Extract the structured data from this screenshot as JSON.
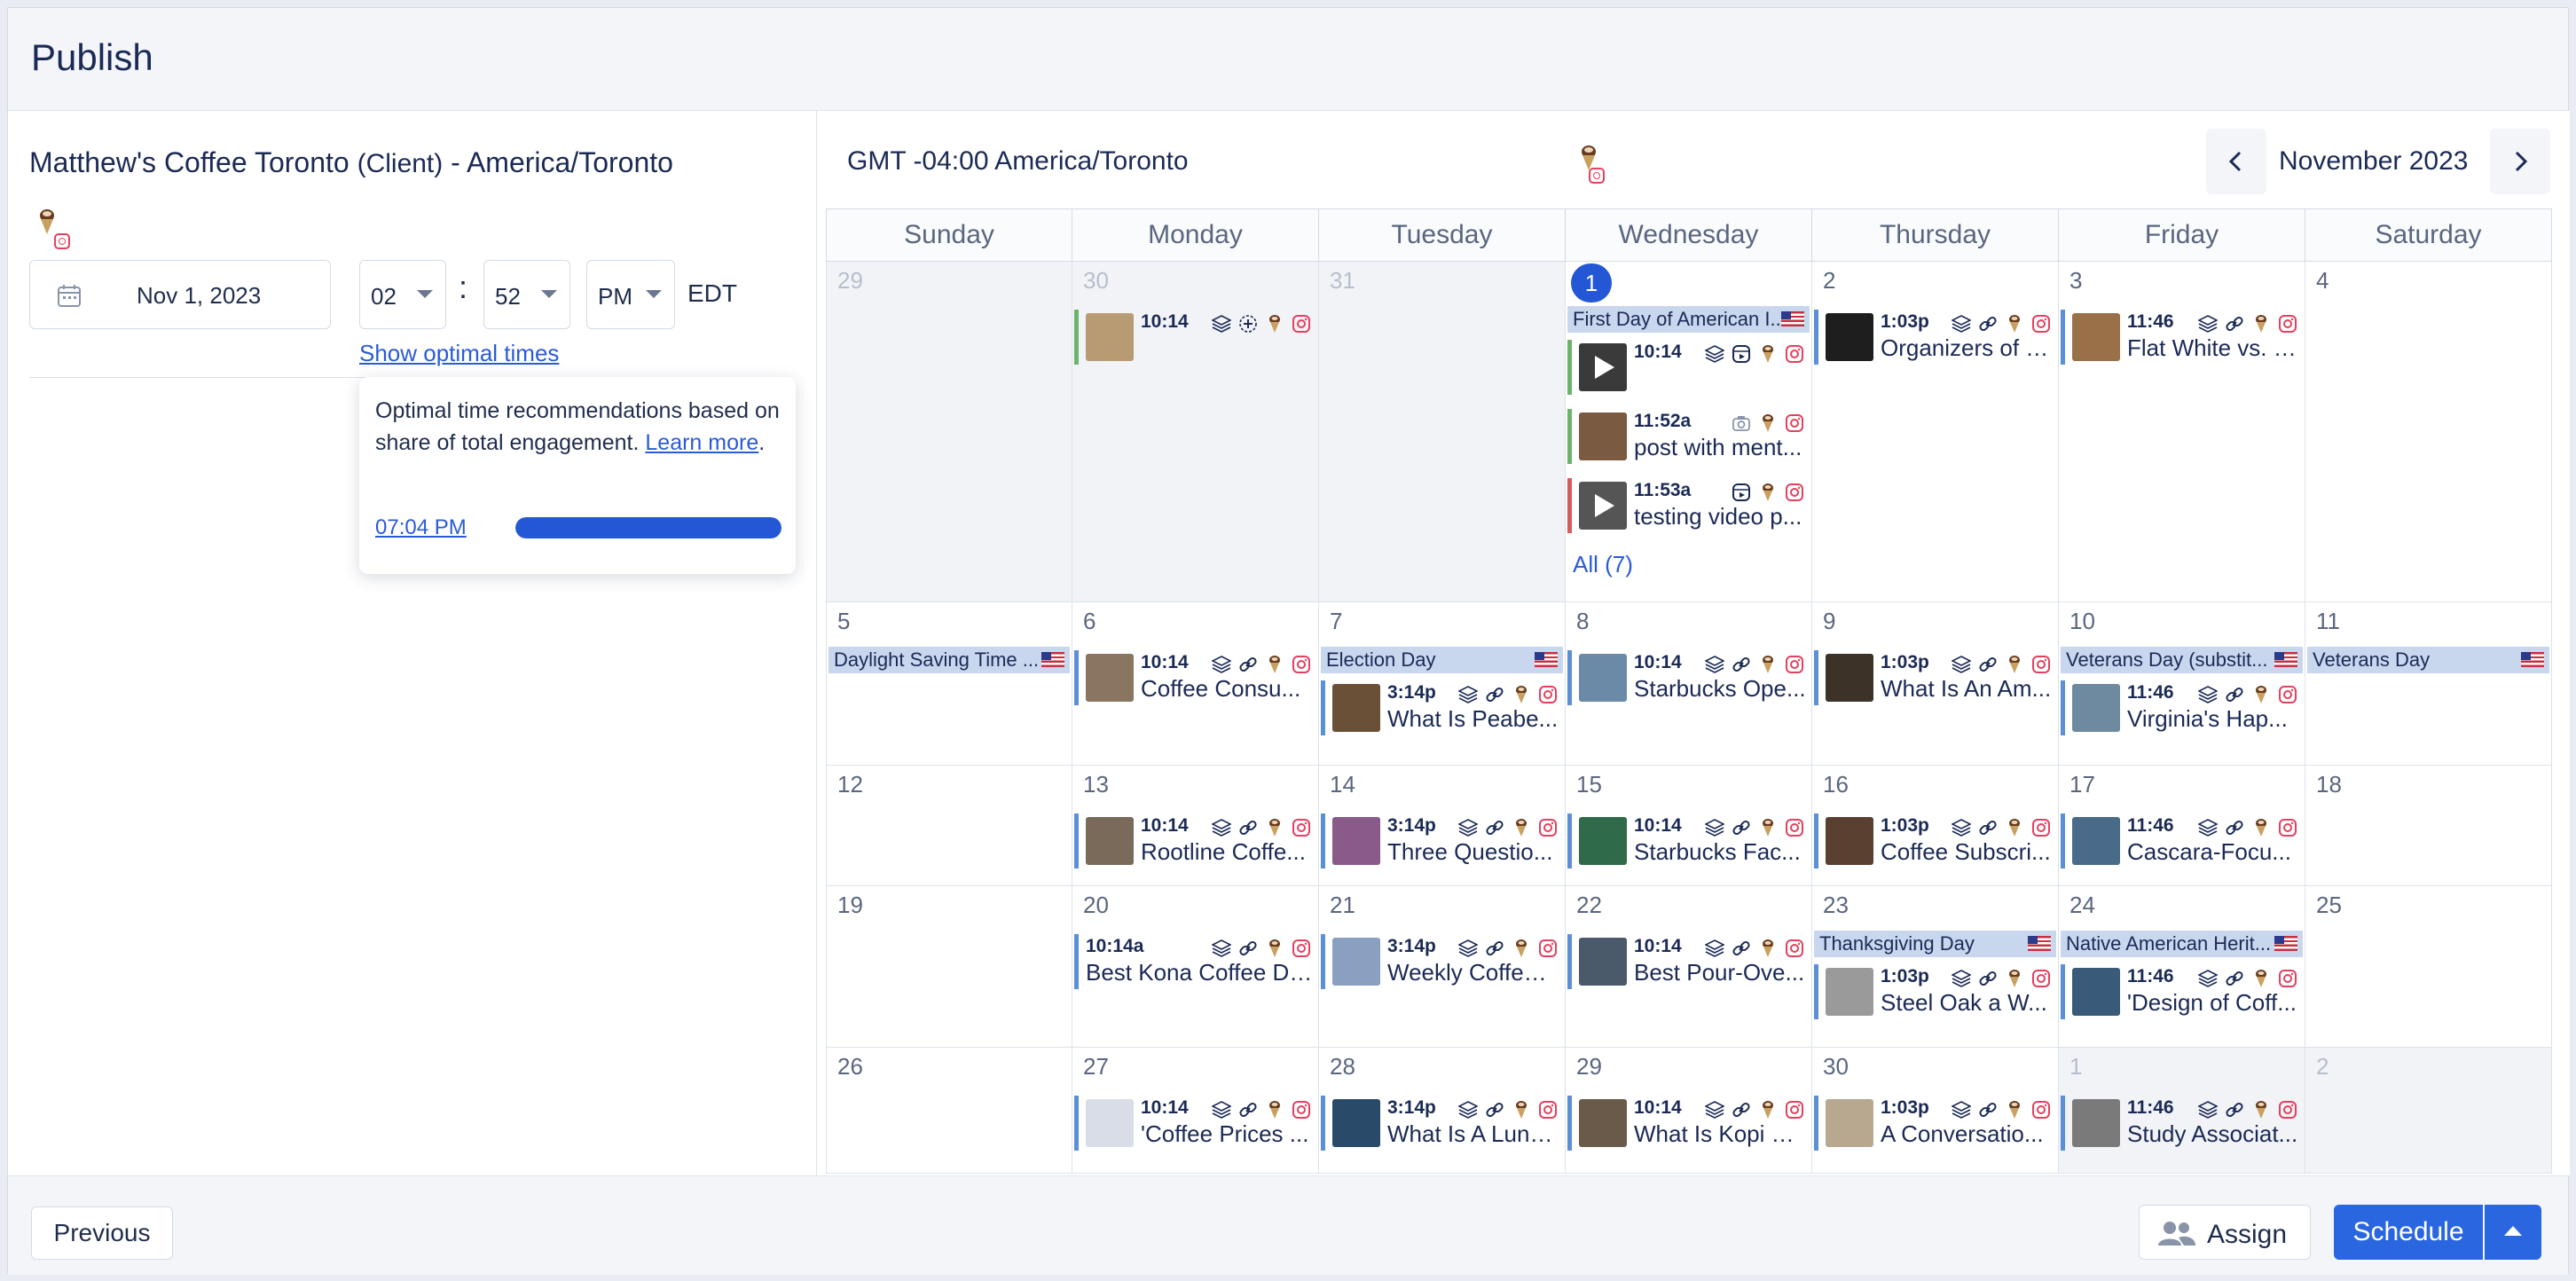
{
  "header": {
    "title": "Publish"
  },
  "left": {
    "account_name": "Matthew's Coffee Toronto",
    "account_type": "(Client)",
    "account_tz": "- America/Toronto",
    "date": "Nov 1, 2023",
    "hour": "02",
    "minute": "52",
    "ampm": "PM",
    "tz_abbr": "EDT",
    "time_separator": ":",
    "optimal_link": "Show optimal times",
    "popover": {
      "desc": "Optimal time recommendations based on share of total engagement.",
      "learn_more": "Learn more",
      "period": ".",
      "recommended_time": "07:04 PM",
      "bar_fraction": 1.0
    }
  },
  "calendar": {
    "timezone": "GMT -04:00 America/Toronto",
    "month": "November 2023",
    "days_of_week": [
      "Sunday",
      "Monday",
      "Tuesday",
      "Wednesday",
      "Thursday",
      "Friday",
      "Saturday"
    ],
    "weeks": [
      {
        "days": [
          {
            "num": "29",
            "out": true,
            "events": []
          },
          {
            "num": "30",
            "out": true,
            "events": [
              {
                "kind": "post",
                "time": "10:14",
                "title": "",
                "border": "green",
                "thumb": "#b89a73",
                "icons": [
                  "layers",
                  "add-circle",
                  "avatar",
                  "instagram"
                ]
              }
            ]
          },
          {
            "num": "31",
            "out": true,
            "events": []
          },
          {
            "num": "1",
            "today": true,
            "events": [
              {
                "kind": "holiday",
                "title": "First Day of American I..."
              },
              {
                "kind": "post",
                "time": "10:14",
                "title": "",
                "border": "green",
                "thumb": "#3a3a3a",
                "play": true,
                "icons": [
                  "layers",
                  "reel",
                  "avatar",
                  "instagram"
                ]
              },
              {
                "kind": "post",
                "time": "11:52a",
                "title": "post with ment...",
                "border": "green",
                "thumb": "#7a5a40",
                "icons": [
                  "camera",
                  "avatar",
                  "instagram"
                ]
              },
              {
                "kind": "post",
                "time": "11:53a",
                "title": "testing video p...",
                "border": "red",
                "thumb": "#555555",
                "play": true,
                "icons": [
                  "reel",
                  "avatar",
                  "instagram"
                ]
              }
            ],
            "all_link": "All (7)"
          },
          {
            "num": "2",
            "events": [
              {
                "kind": "post",
                "time": "1:03p",
                "title": "Organizers of S...",
                "border": "blue",
                "thumb": "#1e1e1e",
                "icons": [
                  "layers",
                  "link",
                  "avatar",
                  "instagram"
                ]
              }
            ]
          },
          {
            "num": "3",
            "events": [
              {
                "kind": "post",
                "time": "11:46",
                "title": "Flat White vs. L...",
                "border": "blue",
                "thumb": "#9a7048",
                "icons": [
                  "layers",
                  "link",
                  "avatar",
                  "instagram"
                ]
              }
            ]
          },
          {
            "num": "4",
            "events": []
          }
        ]
      },
      {
        "days": [
          {
            "num": "5",
            "events": [
              {
                "kind": "holiday",
                "title": "Daylight Saving Time ..."
              }
            ]
          },
          {
            "num": "6",
            "events": [
              {
                "kind": "post",
                "time": "10:14",
                "title": "Coffee Consu...",
                "border": "blue",
                "thumb": "#8a7560",
                "icons": [
                  "layers",
                  "link",
                  "avatar",
                  "instagram"
                ]
              }
            ]
          },
          {
            "num": "7",
            "events": [
              {
                "kind": "holiday",
                "title": "Election Day"
              },
              {
                "kind": "post",
                "time": "3:14p",
                "title": "What Is Peabe...",
                "border": "blue",
                "thumb": "#6b5038",
                "icons": [
                  "layers",
                  "link",
                  "avatar",
                  "instagram"
                ]
              }
            ]
          },
          {
            "num": "8",
            "events": [
              {
                "kind": "post",
                "time": "10:14",
                "title": "Starbucks Ope...",
                "border": "blue",
                "thumb": "#6a8aa8",
                "icons": [
                  "layers",
                  "link",
                  "avatar",
                  "instagram"
                ]
              }
            ]
          },
          {
            "num": "9",
            "events": [
              {
                "kind": "post",
                "time": "1:03p",
                "title": "What Is An Am...",
                "border": "blue",
                "thumb": "#3d3228",
                "icons": [
                  "layers",
                  "link",
                  "avatar",
                  "instagram"
                ]
              }
            ]
          },
          {
            "num": "10",
            "events": [
              {
                "kind": "holiday",
                "title": "Veterans Day (substit..."
              },
              {
                "kind": "post",
                "time": "11:46",
                "title": "Virginia's Hap...",
                "border": "blue",
                "thumb": "#6d8aa0",
                "icons": [
                  "layers",
                  "link",
                  "avatar",
                  "instagram"
                ]
              }
            ]
          },
          {
            "num": "11",
            "events": [
              {
                "kind": "holiday",
                "title": "Veterans Day"
              }
            ]
          }
        ]
      },
      {
        "days": [
          {
            "num": "12",
            "events": []
          },
          {
            "num": "13",
            "events": [
              {
                "kind": "post",
                "time": "10:14",
                "title": "Rootline Coffe...",
                "border": "blue",
                "thumb": "#7a6a5a",
                "icons": [
                  "layers",
                  "link",
                  "avatar",
                  "instagram"
                ]
              }
            ]
          },
          {
            "num": "14",
            "events": [
              {
                "kind": "post",
                "time": "3:14p",
                "title": "Three Questio...",
                "border": "blue",
                "thumb": "#8a5a8a",
                "icons": [
                  "layers",
                  "link",
                  "avatar",
                  "instagram"
                ]
              }
            ]
          },
          {
            "num": "15",
            "events": [
              {
                "kind": "post",
                "time": "10:14",
                "title": "Starbucks Fac...",
                "border": "blue",
                "thumb": "#2f6a4a",
                "icons": [
                  "layers",
                  "link",
                  "avatar",
                  "instagram"
                ]
              }
            ]
          },
          {
            "num": "16",
            "events": [
              {
                "kind": "post",
                "time": "1:03p",
                "title": "Coffee Subscri...",
                "border": "blue",
                "thumb": "#5a4030",
                "icons": [
                  "layers",
                  "link",
                  "avatar",
                  "instagram"
                ]
              }
            ]
          },
          {
            "num": "17",
            "events": [
              {
                "kind": "post",
                "time": "11:46",
                "title": "Cascara-Focu...",
                "border": "blue",
                "thumb": "#4a6a8a",
                "icons": [
                  "layers",
                  "link",
                  "avatar",
                  "instagram"
                ]
              }
            ]
          },
          {
            "num": "18",
            "events": []
          }
        ]
      },
      {
        "days": [
          {
            "num": "19",
            "events": []
          },
          {
            "num": "20",
            "events": [
              {
                "kind": "post",
                "time": "10:14a",
                "title": "Best Kona Coffee Dir...",
                "border": "blue",
                "thumb": "",
                "icons": [
                  "layers",
                  "link",
                  "avatar",
                  "instagram"
                ]
              }
            ]
          },
          {
            "num": "21",
            "events": [
              {
                "kind": "post",
                "time": "3:14p",
                "title": "Weekly Coffee ...",
                "border": "blue",
                "thumb": "#8aa0c0",
                "icons": [
                  "layers",
                  "link",
                  "avatar",
                  "instagram"
                ]
              }
            ]
          },
          {
            "num": "22",
            "events": [
              {
                "kind": "post",
                "time": "10:14",
                "title": "Best Pour-Ove...",
                "border": "blue",
                "thumb": "#4a5a6a",
                "icons": [
                  "layers",
                  "link",
                  "avatar",
                  "instagram"
                ]
              }
            ]
          },
          {
            "num": "23",
            "events": [
              {
                "kind": "holiday",
                "title": "Thanksgiving Day"
              },
              {
                "kind": "post",
                "time": "1:03p",
                "title": "Steel Oak a W...",
                "border": "blue",
                "thumb": "#9a9a9a",
                "icons": [
                  "layers",
                  "link",
                  "avatar",
                  "instagram"
                ]
              }
            ]
          },
          {
            "num": "24",
            "events": [
              {
                "kind": "holiday",
                "title": "Native American Herit..."
              },
              {
                "kind": "post",
                "time": "11:46",
                "title": "'Design of Coff...",
                "border": "blue",
                "thumb": "#3a5a7a",
                "icons": [
                  "layers",
                  "link",
                  "avatar",
                  "instagram"
                ]
              }
            ]
          },
          {
            "num": "25",
            "events": []
          }
        ]
      },
      {
        "days": [
          {
            "num": "26",
            "events": []
          },
          {
            "num": "27",
            "events": [
              {
                "kind": "post",
                "time": "10:14",
                "title": "'Coffee Prices ...",
                "border": "blue",
                "thumb": "#d8dde8",
                "icons": [
                  "layers",
                  "link",
                  "avatar",
                  "instagram"
                ]
              }
            ]
          },
          {
            "num": "28",
            "events": [
              {
                "kind": "post",
                "time": "3:14p",
                "title": "What Is A Lung...",
                "border": "blue",
                "thumb": "#2a4a6a",
                "icons": [
                  "layers",
                  "link",
                  "avatar",
                  "instagram"
                ]
              }
            ]
          },
          {
            "num": "29",
            "events": [
              {
                "kind": "post",
                "time": "10:14",
                "title": "What Is Kopi Lu...",
                "border": "blue",
                "thumb": "#6a5a4a",
                "icons": [
                  "layers",
                  "link",
                  "avatar",
                  "instagram"
                ]
              }
            ]
          },
          {
            "num": "30",
            "events": [
              {
                "kind": "post",
                "time": "1:03p",
                "title": "A Conversatio...",
                "border": "blue",
                "thumb": "#b8a890",
                "icons": [
                  "layers",
                  "link",
                  "avatar",
                  "instagram"
                ]
              }
            ]
          },
          {
            "num": "1",
            "out": true,
            "events": [
              {
                "kind": "post",
                "time": "11:46",
                "title": "Study Associat...",
                "border": "blue",
                "thumb": "#7a7a7a",
                "icons": [
                  "layers",
                  "link",
                  "avatar",
                  "instagram"
                ]
              }
            ]
          },
          {
            "num": "2",
            "out": true,
            "events": []
          }
        ]
      }
    ]
  },
  "footer": {
    "previous_label": "Previous",
    "assign_label": "Assign",
    "schedule_label": "Schedule"
  },
  "colors": {
    "accent": "#2457d6",
    "holiday_bg": "#c8d7ee",
    "post_border_blue": "#5b8fd6",
    "post_border_green": "#6bb56b",
    "post_border_red": "#d65b5b",
    "instagram": "#e4405f"
  }
}
